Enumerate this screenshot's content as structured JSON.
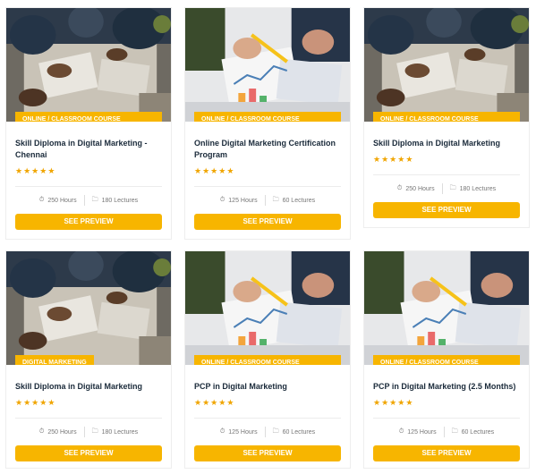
{
  "colors": {
    "accent": "#f7b500",
    "title": "#1a2a3a",
    "meta": "#777777",
    "star": "#f0a500"
  },
  "cards": [
    {
      "category": "ONLINE / CLASSROOM COURSE",
      "title": "Skill Diploma in Digital Marketing - Chennai",
      "hours": "250 Hours",
      "lectures": "180 Lectures",
      "button": "SEE PREVIEW",
      "rating": 5,
      "image": "team-laptops-photo"
    },
    {
      "category": "ONLINE / CLASSROOM COURSE",
      "title": "Online Digital Marketing Certification Program",
      "hours": "125 Hours",
      "lectures": "60 Lectures",
      "button": "SEE PREVIEW",
      "rating": 5,
      "image": "charts-pencil-photo"
    },
    {
      "category": "ONLINE / CLASSROOM COURSE",
      "title": "Skill Diploma in Digital Marketing",
      "hours": "250 Hours",
      "lectures": "180 Lectures",
      "button": "SEE PREVIEW",
      "rating": 5,
      "image": "team-laptops-photo"
    },
    {
      "category": "DIGITAL MARKETING",
      "title": "Skill Diploma in Digital Marketing",
      "hours": "250 Hours",
      "lectures": "180 Lectures",
      "button": "SEE PREVIEW",
      "rating": 5,
      "image": "team-laptops-photo"
    },
    {
      "category": "ONLINE / CLASSROOM COURSE",
      "title": "PCP in Digital Marketing",
      "hours": "125 Hours",
      "lectures": "60 Lectures",
      "button": "SEE PREVIEW",
      "rating": 5,
      "image": "charts-pencil-photo"
    },
    {
      "category": "ONLINE / CLASSROOM COURSE",
      "title": "PCP in Digital Marketing (2.5 Months)",
      "hours": "125 Hours",
      "lectures": "60 Lectures",
      "button": "SEE PREVIEW",
      "rating": 5,
      "image": "charts-pencil-photo"
    }
  ]
}
